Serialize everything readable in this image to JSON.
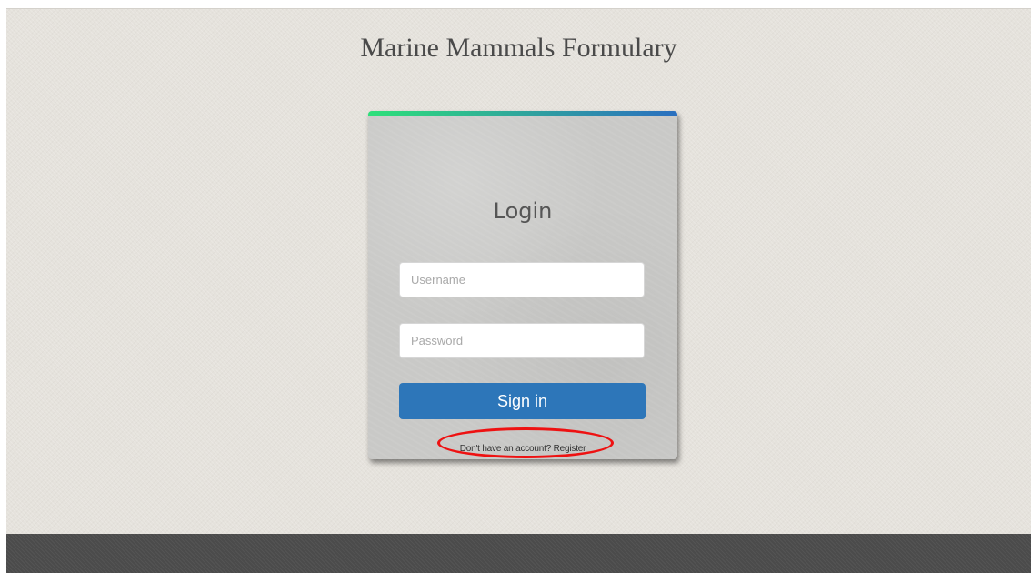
{
  "header": {
    "title": "Marine Mammals Formulary"
  },
  "login": {
    "heading": "Login",
    "username_placeholder": "Username",
    "password_placeholder": "Password",
    "sign_in_label": "Sign in",
    "register_text": "Don't have an account? Register"
  },
  "colors": {
    "primary_button": "#2d76b9",
    "accent_start": "#2ee07a",
    "accent_end": "#2a6fc0",
    "highlight": "#ee1111",
    "footer": "#4b4b4b"
  }
}
